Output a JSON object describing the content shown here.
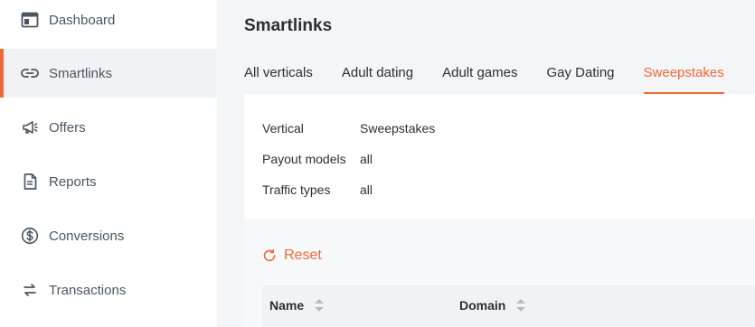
{
  "sidebar": {
    "items": [
      {
        "label": "Dashboard",
        "icon": "dashboard-icon"
      },
      {
        "label": "Smartlinks",
        "icon": "link-icon"
      },
      {
        "label": "Offers",
        "icon": "megaphone-icon"
      },
      {
        "label": "Reports",
        "icon": "document-icon"
      },
      {
        "label": "Conversions",
        "icon": "dollar-icon"
      },
      {
        "label": "Transactions",
        "icon": "swap-icon"
      }
    ],
    "active_index": 1
  },
  "main": {
    "title": "Smartlinks",
    "tabs": [
      {
        "label": "All verticals"
      },
      {
        "label": "Adult dating"
      },
      {
        "label": "Adult games"
      },
      {
        "label": "Gay Dating"
      },
      {
        "label": "Sweepstakes"
      }
    ],
    "active_tab": 4,
    "details": {
      "vertical_label": "Vertical",
      "vertical_value": "Sweepstakes",
      "payout_label": "Payout models",
      "payout_value": "all",
      "traffic_label": "Traffic types",
      "traffic_value": "all"
    },
    "reset_label": "Reset",
    "table": {
      "columns": [
        {
          "label": "Name"
        },
        {
          "label": "Domain"
        }
      ]
    }
  },
  "colors": {
    "accent": "#ee6a3a",
    "sidebar_active_bg": "#f1f2f4",
    "text": "#2b2f36"
  }
}
